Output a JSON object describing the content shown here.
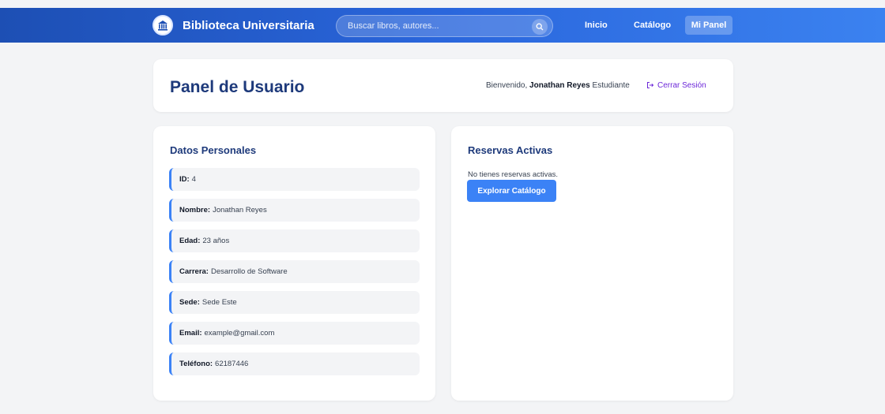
{
  "header": {
    "brand_title": "Biblioteca Universitaria",
    "search_placeholder": "Buscar libros, autores...",
    "nav": {
      "inicio": "Inicio",
      "catalogo": "Catálogo",
      "mi_panel": "Mi Panel"
    }
  },
  "panel": {
    "title": "Panel de Usuario",
    "welcome_prefix": "Bienvenido,",
    "user_name": "Jonathan Reyes",
    "user_role": "Estudiante",
    "logout_label": "Cerrar Sesión"
  },
  "personal": {
    "title": "Datos Personales",
    "rows": [
      {
        "label": "ID:",
        "value": "4"
      },
      {
        "label": "Nombre:",
        "value": "Jonathan Reyes"
      },
      {
        "label": "Edad:",
        "value": "23 años"
      },
      {
        "label": "Carrera:",
        "value": "Desarrollo de Software"
      },
      {
        "label": "Sede:",
        "value": "Sede Este"
      },
      {
        "label": "Email:",
        "value": "example@gmail.com"
      },
      {
        "label": "Teléfono:",
        "value": "62187446"
      }
    ]
  },
  "reservas": {
    "title": "Reservas Activas",
    "empty_text": "No tienes reservas activas.",
    "explore_label": "Explorar Catálogo"
  },
  "icons": {
    "logo": "library-logo-icon",
    "search": "search-icon",
    "logout": "logout-icon"
  },
  "colors": {
    "header_start": "#1d4fb4",
    "header_end": "#3b82f0",
    "title": "#1e3a7b",
    "accent": "#3b82f6",
    "logout": "#6d28d9"
  }
}
